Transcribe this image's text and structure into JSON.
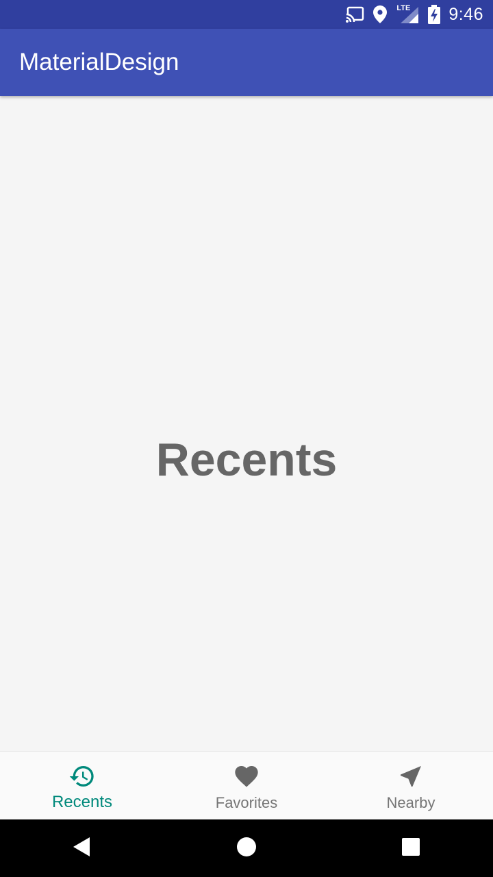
{
  "status_bar": {
    "time": "9:46",
    "network_label": "LTE",
    "icons": [
      "cast-icon",
      "location-icon",
      "lte-signal-icon",
      "battery-charging-icon"
    ]
  },
  "app_bar": {
    "title": "MaterialDesign",
    "color": "#3f51b5",
    "status_color": "#303f9f"
  },
  "content": {
    "label": "Recents"
  },
  "bottom_nav": {
    "active_color": "#00897b",
    "inactive_color": "#757575",
    "items": [
      {
        "label": "Recents",
        "icon": "history-icon",
        "active": true
      },
      {
        "label": "Favorites",
        "icon": "heart-icon",
        "active": false
      },
      {
        "label": "Nearby",
        "icon": "navigation-arrow-icon",
        "active": false
      }
    ]
  },
  "system_nav": {
    "buttons": [
      "back-icon",
      "home-icon",
      "recents-square-icon"
    ]
  }
}
